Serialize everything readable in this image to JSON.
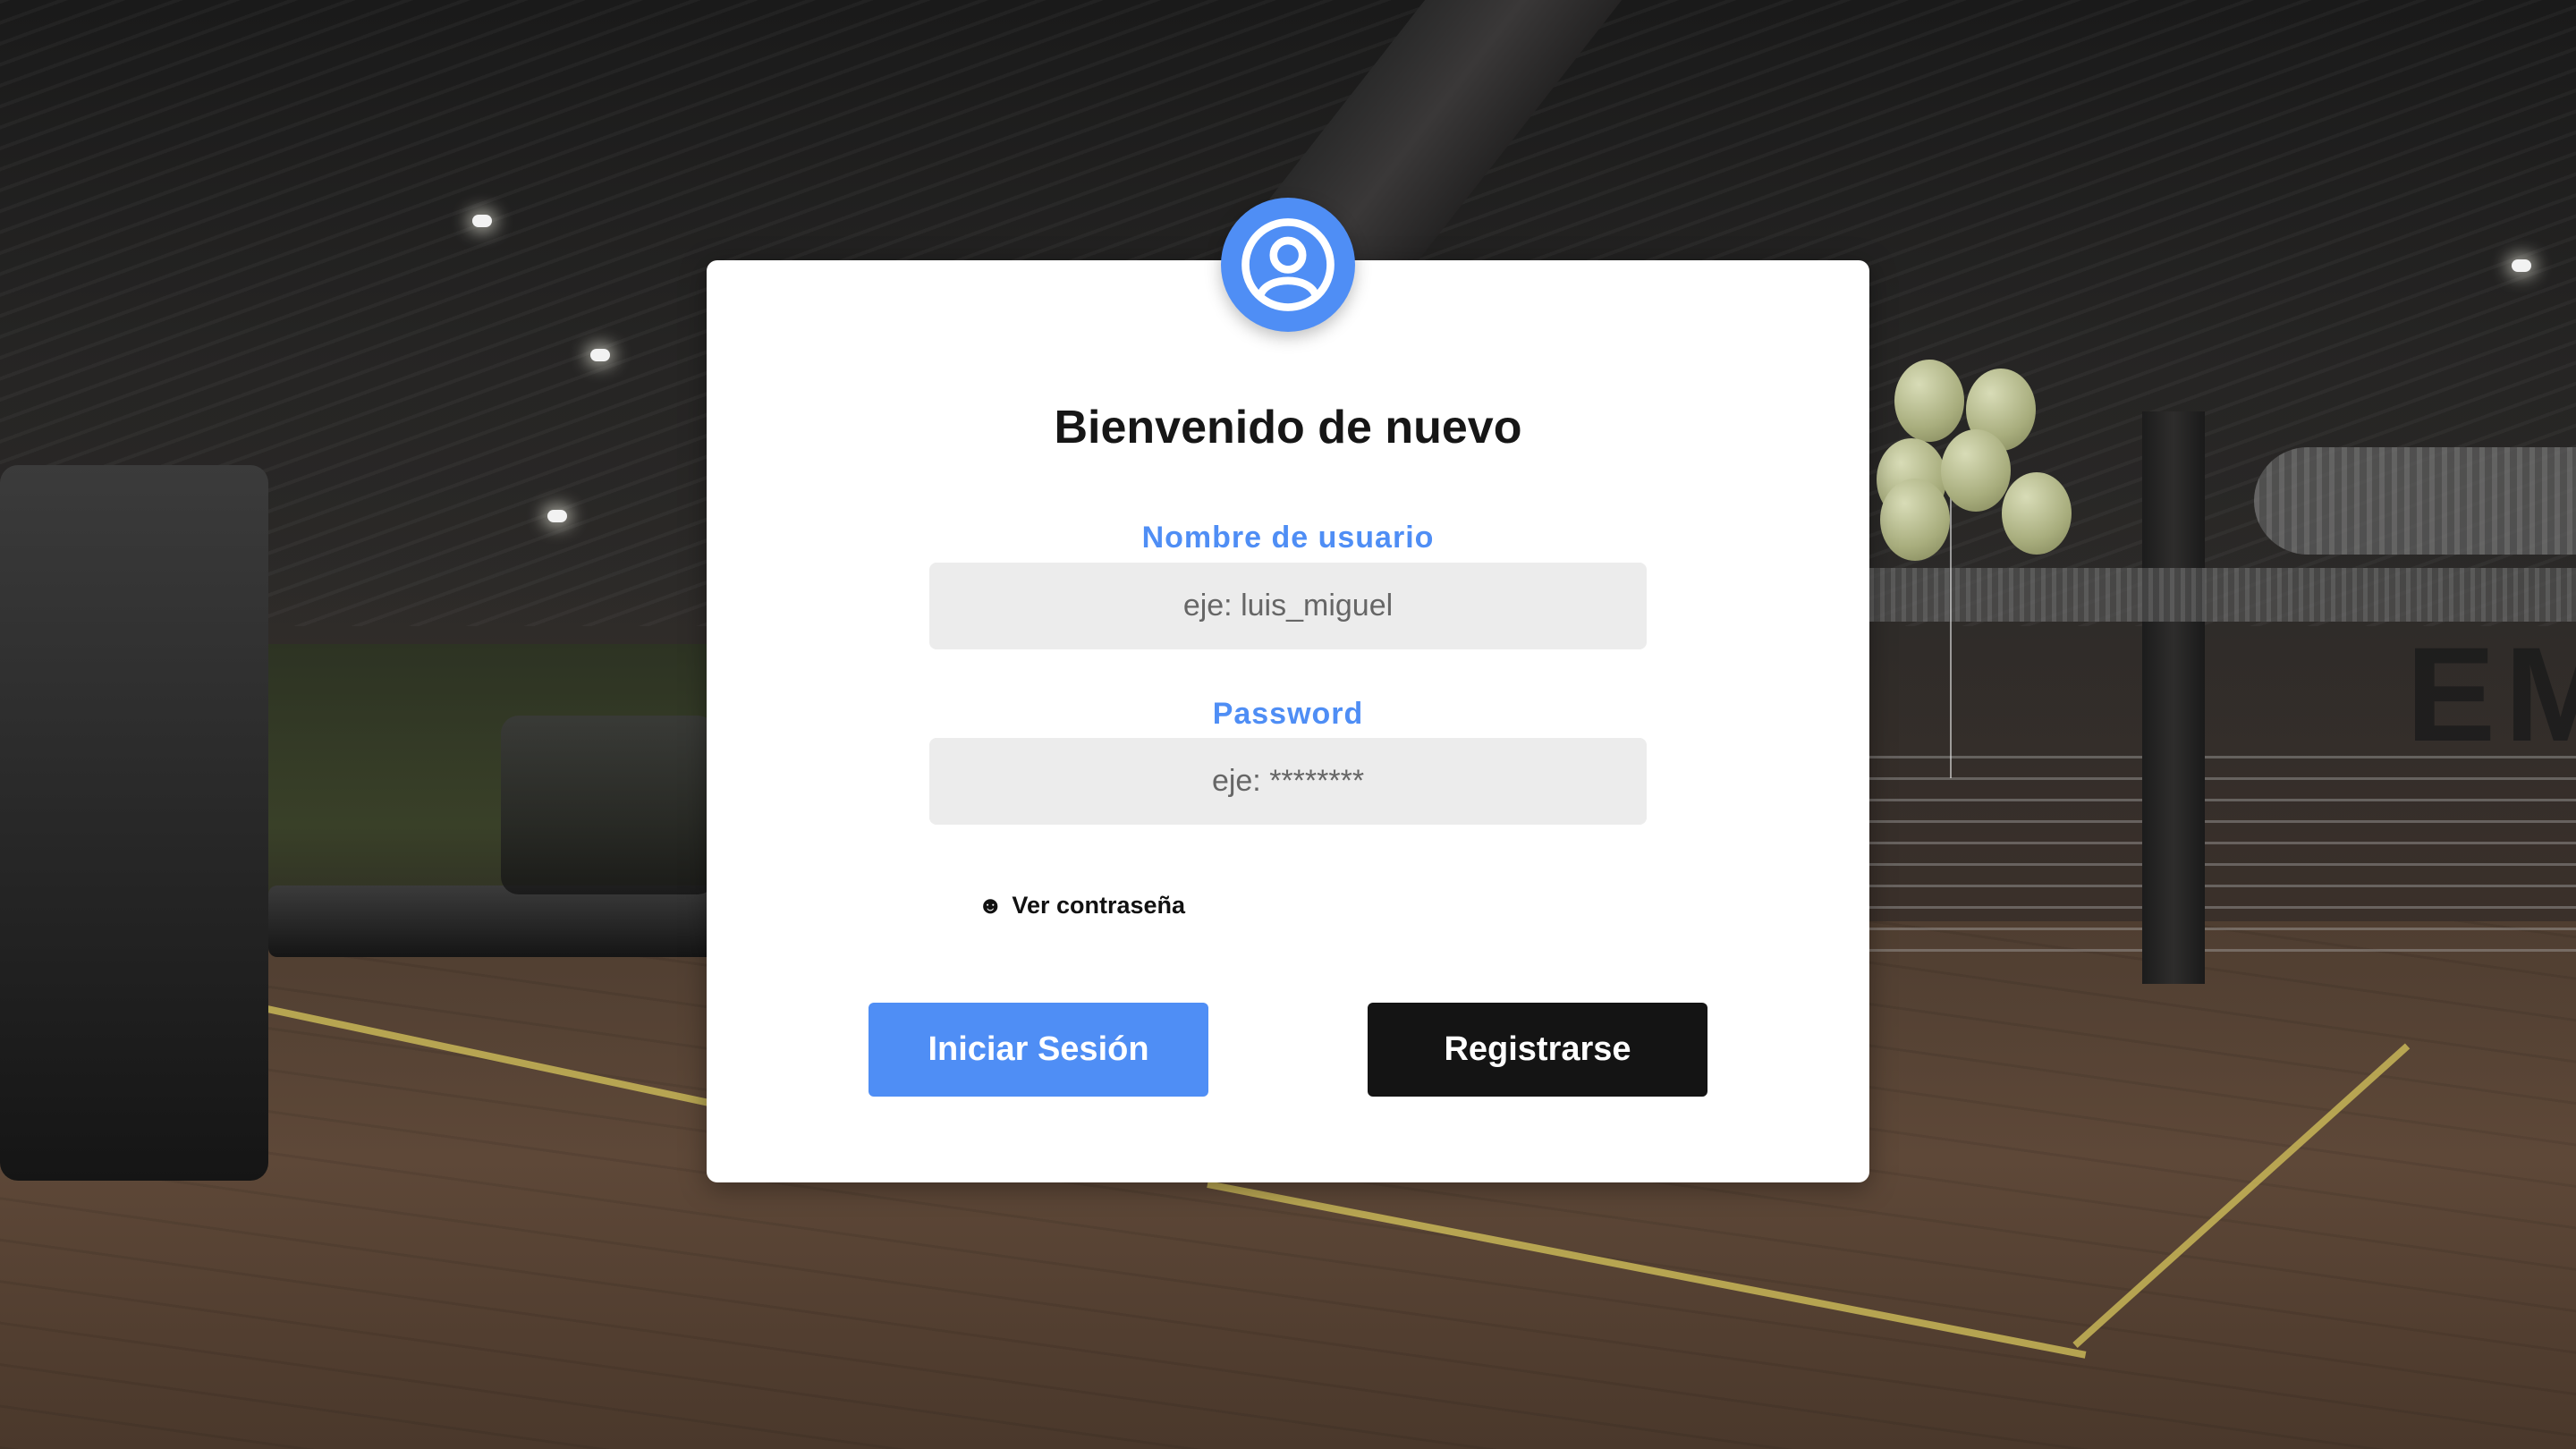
{
  "login": {
    "title": "Bienvenido de nuevo",
    "username_label": "Nombre de usuario",
    "username_placeholder": "eje: luis_miguel",
    "password_label": "Password",
    "password_placeholder": "eje: ********",
    "show_password_label": "Ver contraseña",
    "show_password_icon": "☻",
    "login_button": "Iniciar Sesión",
    "register_button": "Registrarse"
  },
  "background": {
    "letters": "EM"
  },
  "colors": {
    "accent": "#4f8ef5",
    "dark_button": "#141414",
    "input_bg": "#ececec",
    "card_bg": "#ffffff"
  },
  "icons": {
    "avatar": "user-circle-icon",
    "show_password": "face-icon"
  }
}
